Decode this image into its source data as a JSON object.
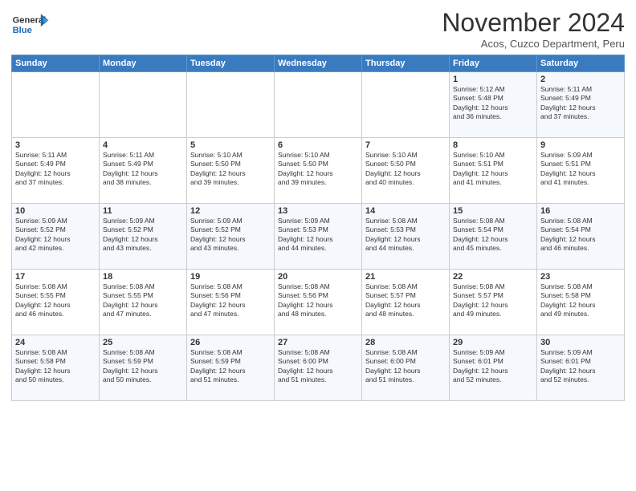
{
  "header": {
    "logo_general": "General",
    "logo_blue": "Blue",
    "month_title": "November 2024",
    "subtitle": "Acos, Cuzco Department, Peru"
  },
  "days_of_week": [
    "Sunday",
    "Monday",
    "Tuesday",
    "Wednesday",
    "Thursday",
    "Friday",
    "Saturday"
  ],
  "weeks": [
    [
      {
        "day": "",
        "info": ""
      },
      {
        "day": "",
        "info": ""
      },
      {
        "day": "",
        "info": ""
      },
      {
        "day": "",
        "info": ""
      },
      {
        "day": "",
        "info": ""
      },
      {
        "day": "1",
        "info": "Sunrise: 5:12 AM\nSunset: 5:48 PM\nDaylight: 12 hours\nand 36 minutes."
      },
      {
        "day": "2",
        "info": "Sunrise: 5:11 AM\nSunset: 5:49 PM\nDaylight: 12 hours\nand 37 minutes."
      }
    ],
    [
      {
        "day": "3",
        "info": "Sunrise: 5:11 AM\nSunset: 5:49 PM\nDaylight: 12 hours\nand 37 minutes."
      },
      {
        "day": "4",
        "info": "Sunrise: 5:11 AM\nSunset: 5:49 PM\nDaylight: 12 hours\nand 38 minutes."
      },
      {
        "day": "5",
        "info": "Sunrise: 5:10 AM\nSunset: 5:50 PM\nDaylight: 12 hours\nand 39 minutes."
      },
      {
        "day": "6",
        "info": "Sunrise: 5:10 AM\nSunset: 5:50 PM\nDaylight: 12 hours\nand 39 minutes."
      },
      {
        "day": "7",
        "info": "Sunrise: 5:10 AM\nSunset: 5:50 PM\nDaylight: 12 hours\nand 40 minutes."
      },
      {
        "day": "8",
        "info": "Sunrise: 5:10 AM\nSunset: 5:51 PM\nDaylight: 12 hours\nand 41 minutes."
      },
      {
        "day": "9",
        "info": "Sunrise: 5:09 AM\nSunset: 5:51 PM\nDaylight: 12 hours\nand 41 minutes."
      }
    ],
    [
      {
        "day": "10",
        "info": "Sunrise: 5:09 AM\nSunset: 5:52 PM\nDaylight: 12 hours\nand 42 minutes."
      },
      {
        "day": "11",
        "info": "Sunrise: 5:09 AM\nSunset: 5:52 PM\nDaylight: 12 hours\nand 43 minutes."
      },
      {
        "day": "12",
        "info": "Sunrise: 5:09 AM\nSunset: 5:52 PM\nDaylight: 12 hours\nand 43 minutes."
      },
      {
        "day": "13",
        "info": "Sunrise: 5:09 AM\nSunset: 5:53 PM\nDaylight: 12 hours\nand 44 minutes."
      },
      {
        "day": "14",
        "info": "Sunrise: 5:08 AM\nSunset: 5:53 PM\nDaylight: 12 hours\nand 44 minutes."
      },
      {
        "day": "15",
        "info": "Sunrise: 5:08 AM\nSunset: 5:54 PM\nDaylight: 12 hours\nand 45 minutes."
      },
      {
        "day": "16",
        "info": "Sunrise: 5:08 AM\nSunset: 5:54 PM\nDaylight: 12 hours\nand 46 minutes."
      }
    ],
    [
      {
        "day": "17",
        "info": "Sunrise: 5:08 AM\nSunset: 5:55 PM\nDaylight: 12 hours\nand 46 minutes."
      },
      {
        "day": "18",
        "info": "Sunrise: 5:08 AM\nSunset: 5:55 PM\nDaylight: 12 hours\nand 47 minutes."
      },
      {
        "day": "19",
        "info": "Sunrise: 5:08 AM\nSunset: 5:56 PM\nDaylight: 12 hours\nand 47 minutes."
      },
      {
        "day": "20",
        "info": "Sunrise: 5:08 AM\nSunset: 5:56 PM\nDaylight: 12 hours\nand 48 minutes."
      },
      {
        "day": "21",
        "info": "Sunrise: 5:08 AM\nSunset: 5:57 PM\nDaylight: 12 hours\nand 48 minutes."
      },
      {
        "day": "22",
        "info": "Sunrise: 5:08 AM\nSunset: 5:57 PM\nDaylight: 12 hours\nand 49 minutes."
      },
      {
        "day": "23",
        "info": "Sunrise: 5:08 AM\nSunset: 5:58 PM\nDaylight: 12 hours\nand 49 minutes."
      }
    ],
    [
      {
        "day": "24",
        "info": "Sunrise: 5:08 AM\nSunset: 5:58 PM\nDaylight: 12 hours\nand 50 minutes."
      },
      {
        "day": "25",
        "info": "Sunrise: 5:08 AM\nSunset: 5:59 PM\nDaylight: 12 hours\nand 50 minutes."
      },
      {
        "day": "26",
        "info": "Sunrise: 5:08 AM\nSunset: 5:59 PM\nDaylight: 12 hours\nand 51 minutes."
      },
      {
        "day": "27",
        "info": "Sunrise: 5:08 AM\nSunset: 6:00 PM\nDaylight: 12 hours\nand 51 minutes."
      },
      {
        "day": "28",
        "info": "Sunrise: 5:08 AM\nSunset: 6:00 PM\nDaylight: 12 hours\nand 51 minutes."
      },
      {
        "day": "29",
        "info": "Sunrise: 5:09 AM\nSunset: 6:01 PM\nDaylight: 12 hours\nand 52 minutes."
      },
      {
        "day": "30",
        "info": "Sunrise: 5:09 AM\nSunset: 6:01 PM\nDaylight: 12 hours\nand 52 minutes."
      }
    ]
  ]
}
